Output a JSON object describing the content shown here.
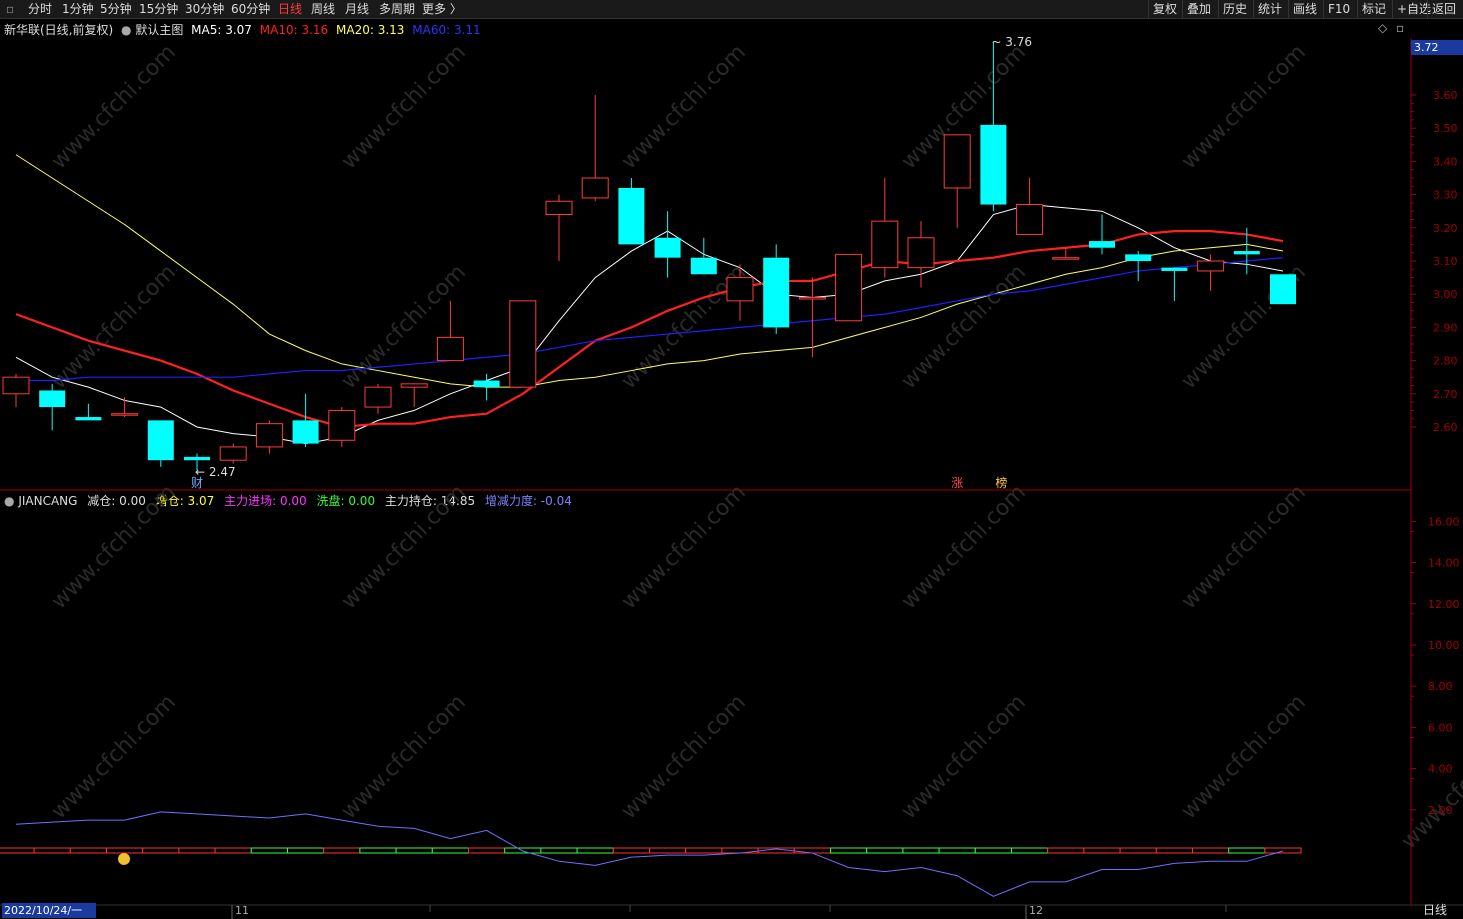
{
  "toolbar": {
    "left": [
      "分时",
      "1分钟",
      "5分钟",
      "15分钟",
      "30分钟",
      "60分钟",
      "日线",
      "周线",
      "月线",
      "多周期",
      "更多 〉"
    ],
    "active_index": 6,
    "right": [
      "复权",
      "叠加",
      "历史",
      "统计",
      "画线",
      "F10",
      "标记",
      "+自选",
      "返回"
    ]
  },
  "main_header": {
    "stock": "新华联(日线,前复权)",
    "template": "默认主图",
    "ma5": "MA5: 3.07",
    "ma10": "MA10: 3.16",
    "ma20": "MA20: 3.13",
    "ma60": "MA60: 3.11"
  },
  "colors": {
    "up": "#ff3b3b",
    "down": "#00ffff",
    "ma5": "#ffffff",
    "ma10": "#ff2020",
    "ma20": "#ffff66",
    "ma60": "#2020ff",
    "axis": "#a00000",
    "sub_line": "#7070ff"
  },
  "price_axis": {
    "current": "3.72",
    "ticks": [
      "3.60",
      "3.50",
      "3.40",
      "3.30",
      "3.20",
      "3.10",
      "3.00",
      "2.90",
      "2.80",
      "2.70",
      "2.60"
    ]
  },
  "candles": [
    {
      "o": 2.7,
      "h": 2.76,
      "l": 2.66,
      "c": 2.75
    },
    {
      "o": 2.71,
      "h": 2.73,
      "l": 2.59,
      "c": 2.66
    },
    {
      "o": 2.63,
      "h": 2.67,
      "l": 2.62,
      "c": 2.62
    },
    {
      "o": 2.64,
      "h": 2.69,
      "l": 2.63,
      "c": 2.64
    },
    {
      "o": 2.62,
      "h": 2.62,
      "l": 2.48,
      "c": 2.5
    },
    {
      "o": 2.51,
      "h": 2.52,
      "l": 2.47,
      "c": 2.5
    },
    {
      "o": 2.5,
      "h": 2.55,
      "l": 2.49,
      "c": 2.54
    },
    {
      "o": 2.54,
      "h": 2.62,
      "l": 2.52,
      "c": 2.61
    },
    {
      "o": 2.62,
      "h": 2.7,
      "l": 2.54,
      "c": 2.55
    },
    {
      "o": 2.56,
      "h": 2.66,
      "l": 2.54,
      "c": 2.65
    },
    {
      "o": 2.66,
      "h": 2.73,
      "l": 2.64,
      "c": 2.72
    },
    {
      "o": 2.72,
      "h": 2.73,
      "l": 2.66,
      "c": 2.73
    },
    {
      "o": 2.8,
      "h": 2.98,
      "l": 2.8,
      "c": 2.87
    },
    {
      "o": 2.74,
      "h": 2.76,
      "l": 2.68,
      "c": 2.72
    },
    {
      "o": 2.72,
      "h": 2.98,
      "l": 2.72,
      "c": 2.98
    },
    {
      "o": 3.24,
      "h": 3.3,
      "l": 3.1,
      "c": 3.28
    },
    {
      "o": 3.29,
      "h": 3.6,
      "l": 3.28,
      "c": 3.35
    },
    {
      "o": 3.32,
      "h": 3.35,
      "l": 3.15,
      "c": 3.15
    },
    {
      "o": 3.17,
      "h": 3.25,
      "l": 3.05,
      "c": 3.11
    },
    {
      "o": 3.11,
      "h": 3.17,
      "l": 3.06,
      "c": 3.06
    },
    {
      "o": 2.98,
      "h": 3.09,
      "l": 2.92,
      "c": 3.05
    },
    {
      "o": 3.11,
      "h": 3.15,
      "l": 2.88,
      "c": 2.9
    },
    {
      "o": 2.99,
      "h": 3.05,
      "l": 2.81,
      "c": 2.99
    },
    {
      "o": 2.92,
      "h": 3.12,
      "l": 2.92,
      "c": 3.12
    },
    {
      "o": 3.08,
      "h": 3.35,
      "l": 3.05,
      "c": 3.22
    },
    {
      "o": 3.08,
      "h": 3.22,
      "l": 3.02,
      "c": 3.17
    },
    {
      "o": 3.32,
      "h": 3.48,
      "l": 3.2,
      "c": 3.48
    },
    {
      "o": 3.51,
      "h": 3.76,
      "l": 3.25,
      "c": 3.27
    },
    {
      "o": 3.18,
      "h": 3.35,
      "l": 3.18,
      "c": 3.27
    },
    {
      "o": 3.11,
      "h": 3.14,
      "l": 3.11,
      "c": 3.11
    },
    {
      "o": 3.16,
      "h": 3.24,
      "l": 3.12,
      "c": 3.14
    },
    {
      "o": 3.12,
      "h": 3.13,
      "l": 3.04,
      "c": 3.1
    },
    {
      "o": 3.08,
      "h": 3.08,
      "l": 2.98,
      "c": 3.07
    },
    {
      "o": 3.07,
      "h": 3.12,
      "l": 3.01,
      "c": 3.1
    },
    {
      "o": 3.13,
      "h": 3.2,
      "l": 3.06,
      "c": 3.12
    },
    {
      "o": 3.06,
      "h": 3.06,
      "l": 2.97,
      "c": 2.97
    }
  ],
  "ma_lines": {
    "ma5": [
      2.81,
      2.75,
      2.72,
      2.68,
      2.66,
      2.6,
      2.58,
      2.57,
      2.55,
      2.57,
      2.62,
      2.65,
      2.7,
      2.74,
      2.78,
      2.92,
      3.05,
      3.13,
      3.19,
      3.12,
      3.08,
      3.0,
      2.99,
      3.0,
      3.04,
      3.06,
      3.1,
      3.24,
      3.27,
      3.26,
      3.25,
      3.2,
      3.14,
      3.1,
      3.09,
      3.07
    ],
    "ma10": [
      2.94,
      2.9,
      2.86,
      2.83,
      2.8,
      2.76,
      2.71,
      2.67,
      2.63,
      2.6,
      2.61,
      2.61,
      2.63,
      2.64,
      2.7,
      2.78,
      2.86,
      2.9,
      2.95,
      2.99,
      3.02,
      3.04,
      3.04,
      3.07,
      3.1,
      3.09,
      3.1,
      3.11,
      3.13,
      3.14,
      3.15,
      3.18,
      3.19,
      3.19,
      3.18,
      3.16
    ],
    "ma20": [
      3.42,
      3.35,
      3.28,
      3.21,
      3.13,
      3.05,
      2.97,
      2.88,
      2.83,
      2.79,
      2.77,
      2.75,
      2.73,
      2.72,
      2.72,
      2.74,
      2.75,
      2.77,
      2.79,
      2.8,
      2.82,
      2.83,
      2.84,
      2.87,
      2.9,
      2.93,
      2.97,
      3.0,
      3.03,
      3.06,
      3.08,
      3.11,
      3.13,
      3.14,
      3.15,
      3.13
    ],
    "ma60": [
      2.74,
      2.74,
      2.75,
      2.75,
      2.75,
      2.75,
      2.75,
      2.76,
      2.77,
      2.77,
      2.78,
      2.79,
      2.8,
      2.81,
      2.82,
      2.84,
      2.86,
      2.87,
      2.88,
      2.89,
      2.9,
      2.91,
      2.92,
      2.93,
      2.94,
      2.96,
      2.98,
      3.0,
      3.01,
      3.03,
      3.05,
      3.07,
      3.08,
      3.09,
      3.1,
      3.11
    ]
  },
  "annotations": {
    "high": "3.76",
    "low": "2.47",
    "event_cai": "财",
    "event_zhang": "涨",
    "event_bang": "榜"
  },
  "sub_header": {
    "name": "JIANCANG",
    "jianhe": "减仓: 0.00",
    "zenghe": "增仓: 3.07",
    "zhuli_jc": "主力进场: 0.00",
    "xipan": "洗盘: 0.00",
    "zhuli_cc": "主力持仓: 14.85",
    "zengjian": "增减力度: -0.04"
  },
  "sub_axis": {
    "ticks": [
      "16.00",
      "14.00",
      "12.00",
      "10.00",
      "8.00",
      "6.00",
      "4.00",
      "2.00"
    ]
  },
  "sub_line": [
    1.3,
    1.4,
    1.5,
    1.5,
    1.9,
    1.8,
    1.7,
    1.6,
    1.8,
    1.5,
    1.2,
    1.1,
    0.6,
    1.0,
    0.0,
    -0.5,
    -0.7,
    -0.3,
    -0.2,
    -0.2,
    -0.1,
    0.1,
    -0.1,
    -0.8,
    -1.0,
    -0.8,
    -1.2,
    -2.2,
    -1.5,
    -1.5,
    -0.9,
    -0.9,
    -0.6,
    -0.5,
    -0.5,
    0.0
  ],
  "sub_bars": [
    "r",
    "r",
    "r",
    "r",
    "r",
    "r",
    "r",
    "g",
    "g",
    "r",
    "g",
    "g",
    "g",
    "r",
    "g",
    "g",
    "g",
    "r",
    "r",
    "r",
    "r",
    "r",
    "r",
    "g",
    "g",
    "g",
    "g",
    "g",
    "g",
    "r",
    "r",
    "r",
    "r",
    "r",
    "g",
    "r"
  ],
  "date_axis": {
    "start": "2022/10/24/一",
    "m11": "11",
    "m12": "12",
    "period": "日线"
  },
  "watermark": "www.cfchi.com"
}
